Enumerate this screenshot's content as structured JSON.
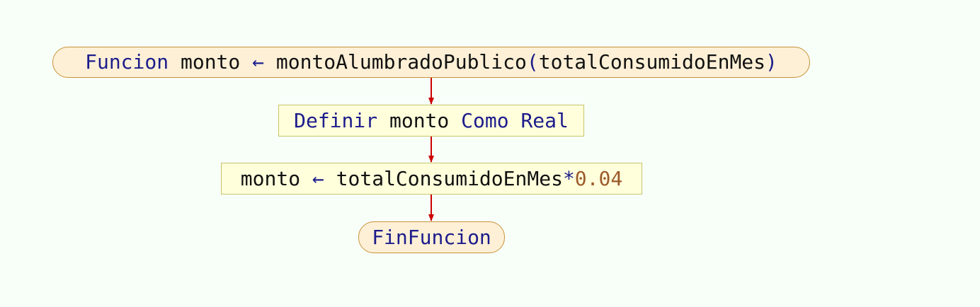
{
  "flowchart": {
    "header": {
      "keyword": "Funcion",
      "return_var": "monto",
      "arrow": "←",
      "function_name": "montoAlumbradoPublico",
      "open_paren": "(",
      "param": "totalConsumidoEnMes",
      "close_paren": ")"
    },
    "define": {
      "keyword": "Definir",
      "var": "monto",
      "as_keyword": "Como",
      "type": "Real"
    },
    "assign": {
      "var": "monto",
      "arrow": "←",
      "operand": "totalConsumidoEnMes",
      "operator": "*",
      "number": "0.04"
    },
    "end": {
      "keyword": "FinFuncion"
    }
  },
  "colors": {
    "background": "#f8fff8",
    "terminal_fill": "#fdf0d6",
    "terminal_border": "#c8923a",
    "process_fill": "#ffffdc",
    "process_border": "#c9c46b",
    "keyword": "#1c1c8c",
    "number": "#9c5a2a",
    "connector": "#cc0000"
  }
}
